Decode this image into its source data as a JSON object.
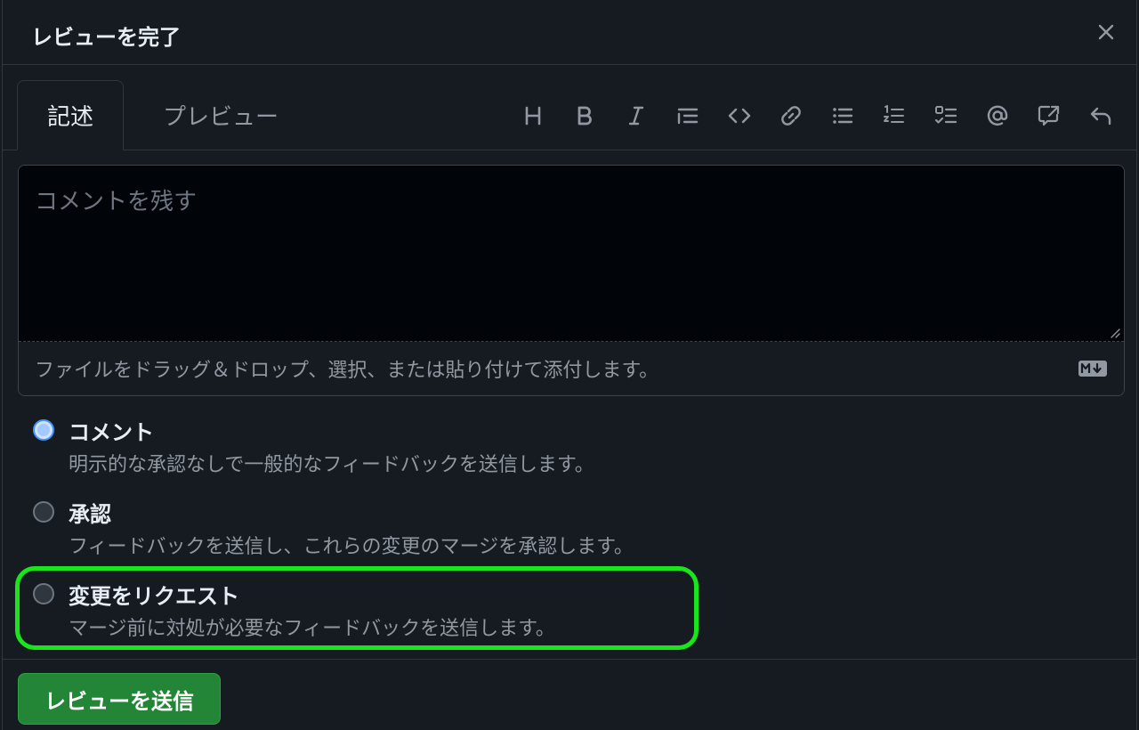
{
  "dialog": {
    "title": "レビューを完了"
  },
  "tabs": {
    "write": "記述",
    "preview": "プレビュー"
  },
  "toolbar": {
    "items": [
      "heading-icon",
      "bold-icon",
      "italic-icon",
      "quote-icon",
      "code-icon",
      "link-icon",
      "bulleted-list-icon",
      "numbered-list-icon",
      "task-list-icon",
      "mention-icon",
      "reference-icon",
      "undo-icon"
    ]
  },
  "editor": {
    "placeholder": "コメントを残す",
    "value": "",
    "attach_text": "ファイルをドラッグ＆ドロップ、選択、または貼り付けて添付します。"
  },
  "options": [
    {
      "title": "コメント",
      "description": "明示的な承認なしで一般的なフィードバックを送信します。",
      "checked": true
    },
    {
      "title": "承認",
      "description": "フィードバックを送信し、これらの変更のマージを承認します。",
      "checked": false
    },
    {
      "title": "変更をリクエスト",
      "description": "マージ前に対処が必要なフィードバックを送信します。",
      "checked": false
    }
  ],
  "submit": {
    "label": "レビューを送信"
  },
  "colors": {
    "background": "#161b22",
    "submit": "#238636",
    "highlight": "#1ae51a",
    "radio_checked": "#4493f8"
  }
}
